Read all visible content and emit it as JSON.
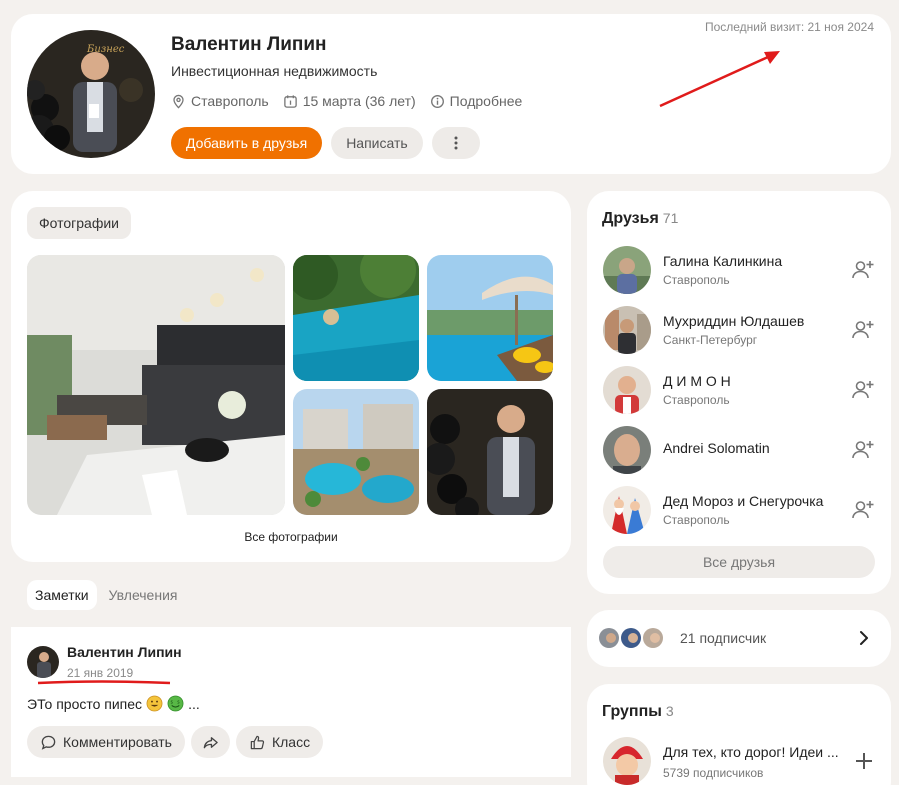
{
  "profile": {
    "name": "Валентин Липин",
    "subtitle": "Инвестиционная недвижимость",
    "city": "Ставрополь",
    "birthday": "15 марта (36 лет)",
    "more": "Подробнее",
    "add_friend": "Добавить в друзья",
    "write": "Написать",
    "last_visit": "Последний визит: 21 ноя 2024"
  },
  "photos": {
    "tab": "Фотографии",
    "all": "Все фотографии"
  },
  "notes": {
    "tabs": [
      "Заметки",
      "Увлечения"
    ]
  },
  "post": {
    "author": "Валентин Липин",
    "date": "21 янв 2019",
    "text": "ЭТо просто пипес",
    "ellipsis": "...",
    "comment": "Комментировать",
    "like": "Класс"
  },
  "friends": {
    "title": "Друзья",
    "count": "71",
    "items": [
      {
        "name": "Галина Калинкина",
        "city": "Ставрополь"
      },
      {
        "name": "Мухриддин Юлдашев",
        "city": "Санкт-Петербург"
      },
      {
        "name": "Д И М О Н",
        "city": "Ставрополь"
      },
      {
        "name": "Andrei Solomatin",
        "city": ""
      },
      {
        "name": "Дед Мороз и Снегурочка",
        "city": "Ставрополь"
      }
    ],
    "all": "Все друзья"
  },
  "subscribers": {
    "text": "21 подписчик"
  },
  "groups": {
    "title": "Группы",
    "count": "3",
    "items": [
      {
        "name": "Для тех, кто дорог! Идеи ...",
        "members": "5739 подписчиков"
      }
    ]
  },
  "colors": {
    "accent": "#f07100",
    "background": "#f4f1ee",
    "annotation": "#e01b1b"
  }
}
